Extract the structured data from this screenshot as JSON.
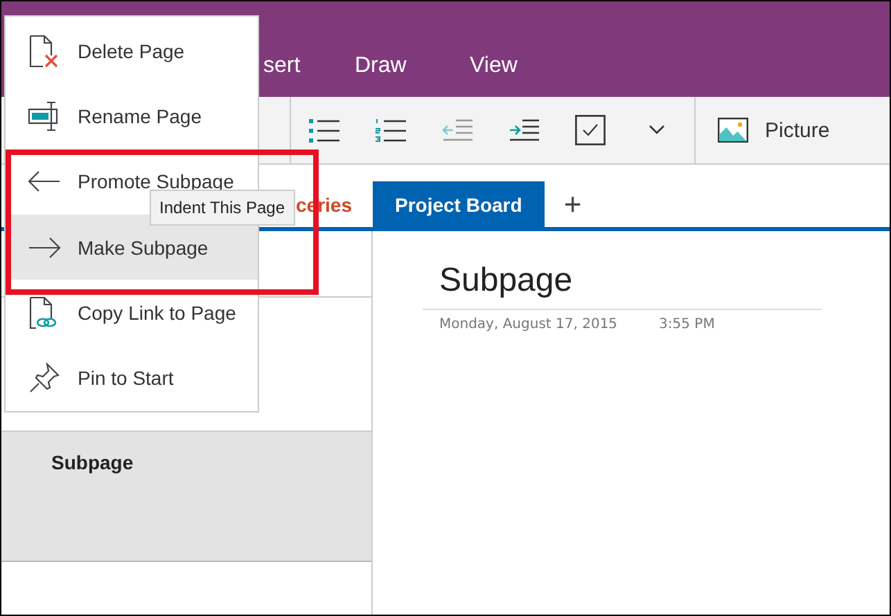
{
  "ribbon": {
    "tabs": [
      {
        "label": "sert"
      },
      {
        "label": "Draw"
      },
      {
        "label": "View"
      }
    ]
  },
  "toolbar": {
    "buttons": [
      {
        "kind": "bullets"
      },
      {
        "kind": "numbering"
      },
      {
        "kind": "outdent"
      },
      {
        "kind": "indent"
      },
      {
        "kind": "checkbox"
      },
      {
        "kind": "more"
      },
      {
        "kind": "picture",
        "label": "Picture"
      }
    ]
  },
  "sections": {
    "tabs": [
      {
        "label": "ceries",
        "selected": false,
        "color": "#d24726"
      },
      {
        "label": "Project Board",
        "selected": true,
        "color": "#0063b1"
      }
    ],
    "add": "+"
  },
  "pages": [
    {
      "title": "Subpage",
      "selected": true
    }
  ],
  "page": {
    "title": "Subpage",
    "date": "Monday, August 17, 2015",
    "time": "3:55 PM"
  },
  "context_menu": {
    "items": [
      {
        "kind": "delete",
        "label": "Delete Page",
        "selected": false
      },
      {
        "kind": "rename",
        "label": "Rename Page",
        "selected": false
      },
      {
        "kind": "promote",
        "label": "Promote Subpage",
        "selected": false
      },
      {
        "kind": "make",
        "label": "Make Subpage",
        "selected": true
      },
      {
        "kind": "copy",
        "label": "Copy Link to Page",
        "selected": false
      },
      {
        "kind": "pin",
        "label": "Pin to Start",
        "selected": false
      }
    ]
  },
  "tooltip": "Indent This Page"
}
